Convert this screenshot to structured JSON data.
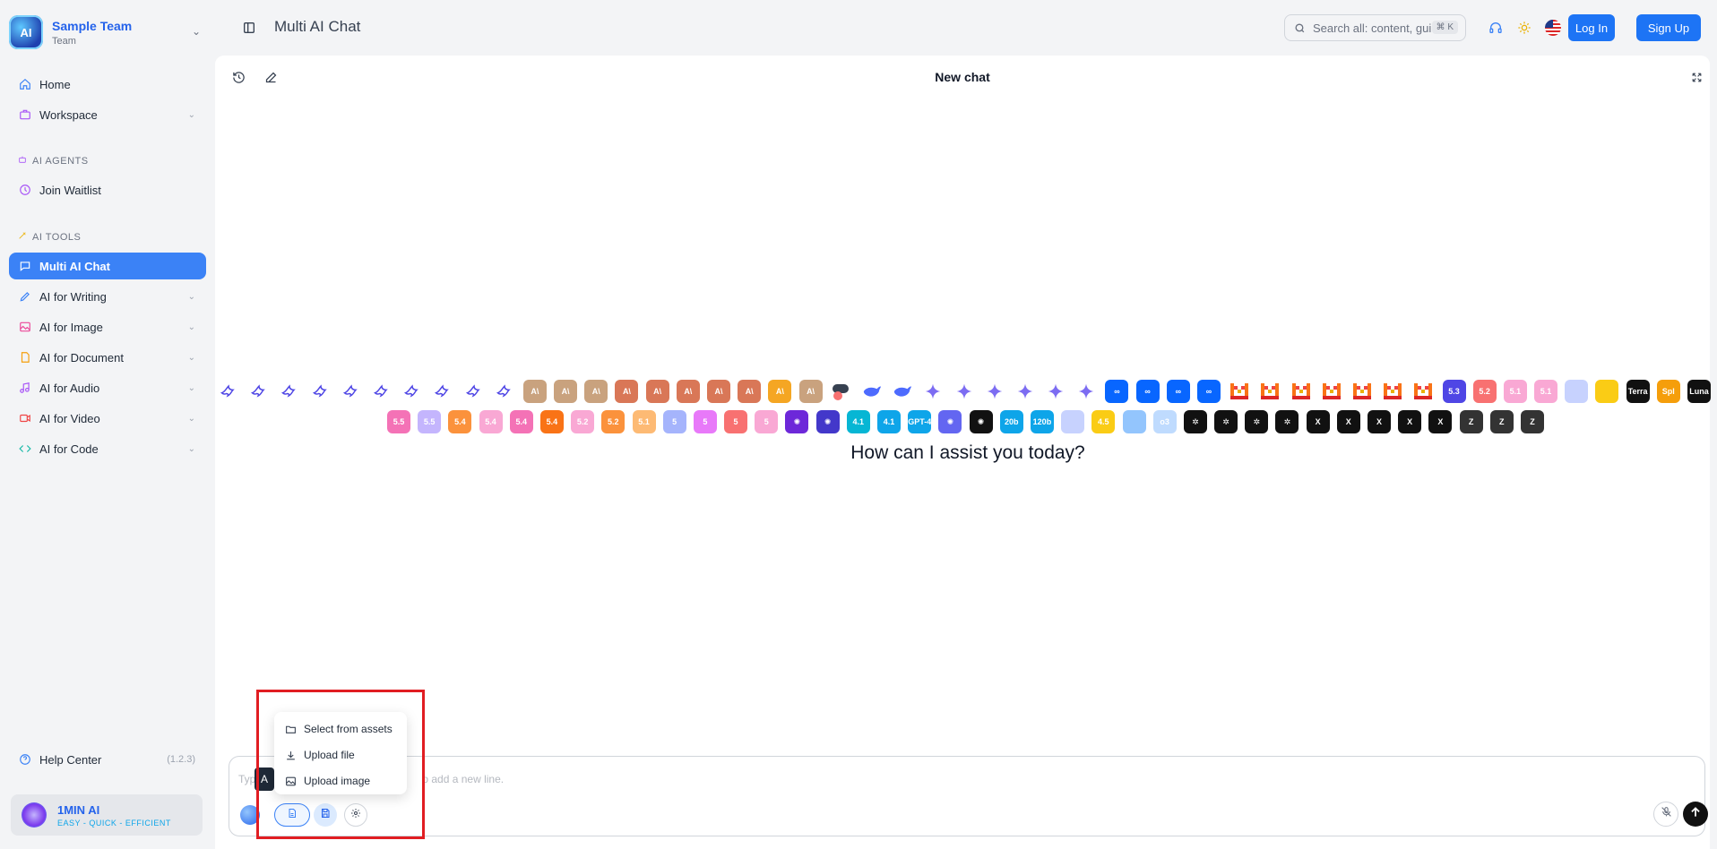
{
  "team": {
    "name": "Sample Team",
    "sub": "Team",
    "logo_text": "AI"
  },
  "sidebar": {
    "home": "Home",
    "workspace": "Workspace",
    "ai_agents_label": "AI AGENTS",
    "join_waitlist": "Join Waitlist",
    "ai_tools_label": "AI TOOLS",
    "items": [
      {
        "label": "Multi AI Chat"
      },
      {
        "label": "AI for Writing"
      },
      {
        "label": "AI for Image"
      },
      {
        "label": "AI for Document"
      },
      {
        "label": "AI for Audio"
      },
      {
        "label": "AI for Video"
      },
      {
        "label": "AI for Code"
      }
    ],
    "help_center": "Help Center",
    "version": "(1.2.3)"
  },
  "brand": {
    "name": "1MIN AI",
    "tagline": "EASY - QUICK - EFFICIENT"
  },
  "header": {
    "title": "Multi AI Chat",
    "search_placeholder": "Search all: content, gui",
    "search_shortcut": "⌘ K",
    "login": "Log In",
    "signup": "Sign Up"
  },
  "chat": {
    "title": "New chat",
    "greeting": "How can I assist you today?",
    "input_placeholder": "Typ",
    "input_placeholder_tail": "o add a new line.",
    "tooltip_char": "A"
  },
  "popup": {
    "items": [
      {
        "label": "Select from assets",
        "icon": "folder-icon"
      },
      {
        "label": "Upload file",
        "icon": "upload-icon"
      },
      {
        "label": "Upload image",
        "icon": "image-icon"
      }
    ]
  },
  "models_row1": [
    {
      "c": "#fff",
      "t": "",
      "k": "wing"
    },
    {
      "c": "#fff",
      "t": "",
      "k": "wing"
    },
    {
      "c": "#fff",
      "t": "",
      "k": "wing"
    },
    {
      "c": "#fff",
      "t": "",
      "k": "wing"
    },
    {
      "c": "#fff",
      "t": "",
      "k": "wing"
    },
    {
      "c": "#fff",
      "t": "",
      "k": "wing"
    },
    {
      "c": "#fff",
      "t": "",
      "k": "wing"
    },
    {
      "c": "#fff",
      "t": "",
      "k": "wing"
    },
    {
      "c": "#fff",
      "t": "",
      "k": "wing"
    },
    {
      "c": "#fff",
      "t": "",
      "k": "wing"
    },
    {
      "c": "#c9a27e",
      "t": "A\\",
      "k": "box"
    },
    {
      "c": "#c9a27e",
      "t": "A\\",
      "k": "box"
    },
    {
      "c": "#c9a27e",
      "t": "A\\",
      "k": "box"
    },
    {
      "c": "#d97757",
      "t": "A\\",
      "k": "box"
    },
    {
      "c": "#d97757",
      "t": "A\\",
      "k": "box"
    },
    {
      "c": "#d97757",
      "t": "A\\",
      "k": "box"
    },
    {
      "c": "#d97757",
      "t": "A\\",
      "k": "box"
    },
    {
      "c": "#d97757",
      "t": "A\\",
      "k": "box"
    },
    {
      "c": "#f5a623",
      "t": "A\\",
      "k": "box"
    },
    {
      "c": "#c9a27e",
      "t": "A\\",
      "k": "box"
    },
    {
      "c": "#fff",
      "t": "",
      "k": "blob"
    },
    {
      "c": "#fff",
      "t": "",
      "k": "whale"
    },
    {
      "c": "#fff",
      "t": "",
      "k": "whale"
    },
    {
      "c": "#fff",
      "t": "",
      "k": "star"
    },
    {
      "c": "#fff",
      "t": "",
      "k": "star"
    },
    {
      "c": "#fff",
      "t": "",
      "k": "star"
    },
    {
      "c": "#fff",
      "t": "",
      "k": "star"
    },
    {
      "c": "#fff",
      "t": "",
      "k": "star"
    },
    {
      "c": "#fff",
      "t": "",
      "k": "star"
    },
    {
      "c": "#0866ff",
      "t": "∞",
      "k": "box"
    },
    {
      "c": "#0866ff",
      "t": "∞",
      "k": "box"
    },
    {
      "c": "#0866ff",
      "t": "∞",
      "k": "box"
    },
    {
      "c": "#0866ff",
      "t": "∞",
      "k": "box"
    },
    {
      "c": "#fff",
      "t": "",
      "k": "mistral"
    },
    {
      "c": "#fff",
      "t": "",
      "k": "mistral"
    },
    {
      "c": "#fff",
      "t": "",
      "k": "mistral"
    },
    {
      "c": "#fff",
      "t": "",
      "k": "mistral"
    },
    {
      "c": "#fff",
      "t": "",
      "k": "mistral"
    },
    {
      "c": "#fff",
      "t": "",
      "k": "mistral"
    },
    {
      "c": "#fff",
      "t": "",
      "k": "mistral"
    },
    {
      "c": "#4f46e5",
      "t": "5.3",
      "k": "box"
    },
    {
      "c": "#f87171",
      "t": "5.2",
      "k": "box"
    },
    {
      "c": "#f9a8d4",
      "t": "5.1",
      "k": "box"
    },
    {
      "c": "#f9a8d4",
      "t": "5.1",
      "k": "box"
    },
    {
      "c": "#c7d2fe",
      "t": "",
      "k": "box"
    },
    {
      "c": "#facc15",
      "t": "",
      "k": "box"
    },
    {
      "c": "#111",
      "t": "Terra",
      "k": "box"
    },
    {
      "c": "#f59e0b",
      "t": "Spl",
      "k": "box"
    },
    {
      "c": "#111",
      "t": "Luna",
      "k": "box"
    }
  ],
  "models_row2": [
    {
      "c": "#f472b6",
      "t": "5.5"
    },
    {
      "c": "#c4b5fd",
      "t": "5.5"
    },
    {
      "c": "#fb923c",
      "t": "5.4"
    },
    {
      "c": "#f9a8d4",
      "t": "5.4"
    },
    {
      "c": "#f472b6",
      "t": "5.4"
    },
    {
      "c": "#f97316",
      "t": "5.4"
    },
    {
      "c": "#f9a8d4",
      "t": "5.2"
    },
    {
      "c": "#fb923c",
      "t": "5.2"
    },
    {
      "c": "#fdba74",
      "t": "5.1"
    },
    {
      "c": "#a5b4fc",
      "t": "5"
    },
    {
      "c": "#e879f9",
      "t": "5"
    },
    {
      "c": "#f87171",
      "t": "5"
    },
    {
      "c": "#f9a8d4",
      "t": "5"
    },
    {
      "c": "#6d28d9",
      "t": "✺"
    },
    {
      "c": "#4338ca",
      "t": "✺"
    },
    {
      "c": "#06b6d4",
      "t": "4.1"
    },
    {
      "c": "#0ea5e9",
      "t": "4.1"
    },
    {
      "c": "#0ea5e9",
      "t": "GPT-4"
    },
    {
      "c": "#6366f1",
      "t": "✺"
    },
    {
      "c": "#111",
      "t": "✺"
    },
    {
      "c": "#0ea5e9",
      "t": "20b"
    },
    {
      "c": "#0ea5e9",
      "t": "120b"
    },
    {
      "c": "#c7d2fe",
      "t": ""
    },
    {
      "c": "#facc15",
      "t": "4.5"
    },
    {
      "c": "#93c5fd",
      "t": ""
    },
    {
      "c": "#bfdbfe",
      "t": "o3"
    },
    {
      "c": "#111",
      "t": "✲"
    },
    {
      "c": "#111",
      "t": "✲"
    },
    {
      "c": "#111",
      "t": "✲"
    },
    {
      "c": "#111",
      "t": "✲"
    },
    {
      "c": "#111",
      "t": "X"
    },
    {
      "c": "#111",
      "t": "X"
    },
    {
      "c": "#111",
      "t": "X"
    },
    {
      "c": "#111",
      "t": "X"
    },
    {
      "c": "#111",
      "t": "X"
    },
    {
      "c": "#333",
      "t": "Z"
    },
    {
      "c": "#333",
      "t": "Z"
    },
    {
      "c": "#333",
      "t": "Z"
    }
  ]
}
